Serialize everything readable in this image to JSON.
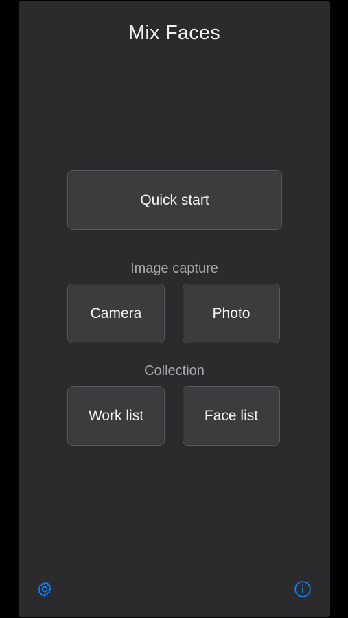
{
  "app": {
    "title": "Mix Faces"
  },
  "main": {
    "quick_start_label": "Quick start",
    "image_capture": {
      "label": "Image capture",
      "camera_label": "Camera",
      "photo_label": "Photo"
    },
    "collection": {
      "label": "Collection",
      "work_list_label": "Work list",
      "face_list_label": "Face list"
    }
  },
  "toolbar": {
    "settings_icon": "gear-icon",
    "info_icon": "info-icon"
  },
  "colors": {
    "background": "#2b2b2d",
    "button": "#3c3c3f",
    "accent": "#0a84ff"
  }
}
